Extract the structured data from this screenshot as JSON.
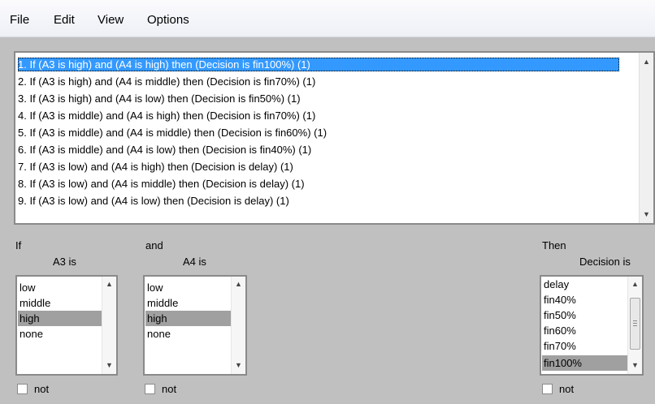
{
  "menu": [
    "File",
    "Edit",
    "View",
    "Options"
  ],
  "rules": [
    "1. If (A3 is high) and (A4 is high) then (Decision is fin100%) (1)",
    "2. If (A3 is high) and (A4 is middle) then (Decision is fin70%) (1)",
    "3. If (A3 is high) and (A4 is low) then (Decision is fin50%) (1)",
    "4. If (A3 is middle) and (A4 is high) then (Decision is fin70%) (1)",
    "5. If (A3 is middle) and (A4 is middle) then (Decision is fin60%) (1)",
    "6. If (A3 is middle) and (A4 is low) then (Decision is fin40%) (1)",
    "7. If (A3 is low) and (A4 is high) then (Decision is delay) (1)",
    "8. If (A3 is low) and (A4 is middle) then (Decision is delay) (1)",
    "9. If (A3 is low) and (A4 is low) then (Decision is delay) (1)"
  ],
  "selected_rule_index": 0,
  "if_label": "If",
  "and_label": "and",
  "then_label": "Then",
  "a3": {
    "title": "A3 is",
    "options": [
      "low",
      "middle",
      "high",
      "none"
    ],
    "selected": "high",
    "not_label": "not",
    "not_checked": false
  },
  "a4": {
    "title": "A4 is",
    "options": [
      "low",
      "middle",
      "high",
      "none"
    ],
    "selected": "high",
    "not_label": "not",
    "not_checked": false
  },
  "decision": {
    "title": "Decision is",
    "options": [
      "delay",
      "fin40%",
      "fin50%",
      "fin60%",
      "fin70%",
      "fin100%"
    ],
    "selected": "fin100%",
    "not_label": "not",
    "not_checked": false
  },
  "colors": {
    "selection": "#3399ff",
    "list_selected": "#a0a0a0",
    "background": "#c0c0c0"
  },
  "icons": {
    "scroll_up": "triangle-up-icon",
    "scroll_down": "triangle-down-icon"
  }
}
